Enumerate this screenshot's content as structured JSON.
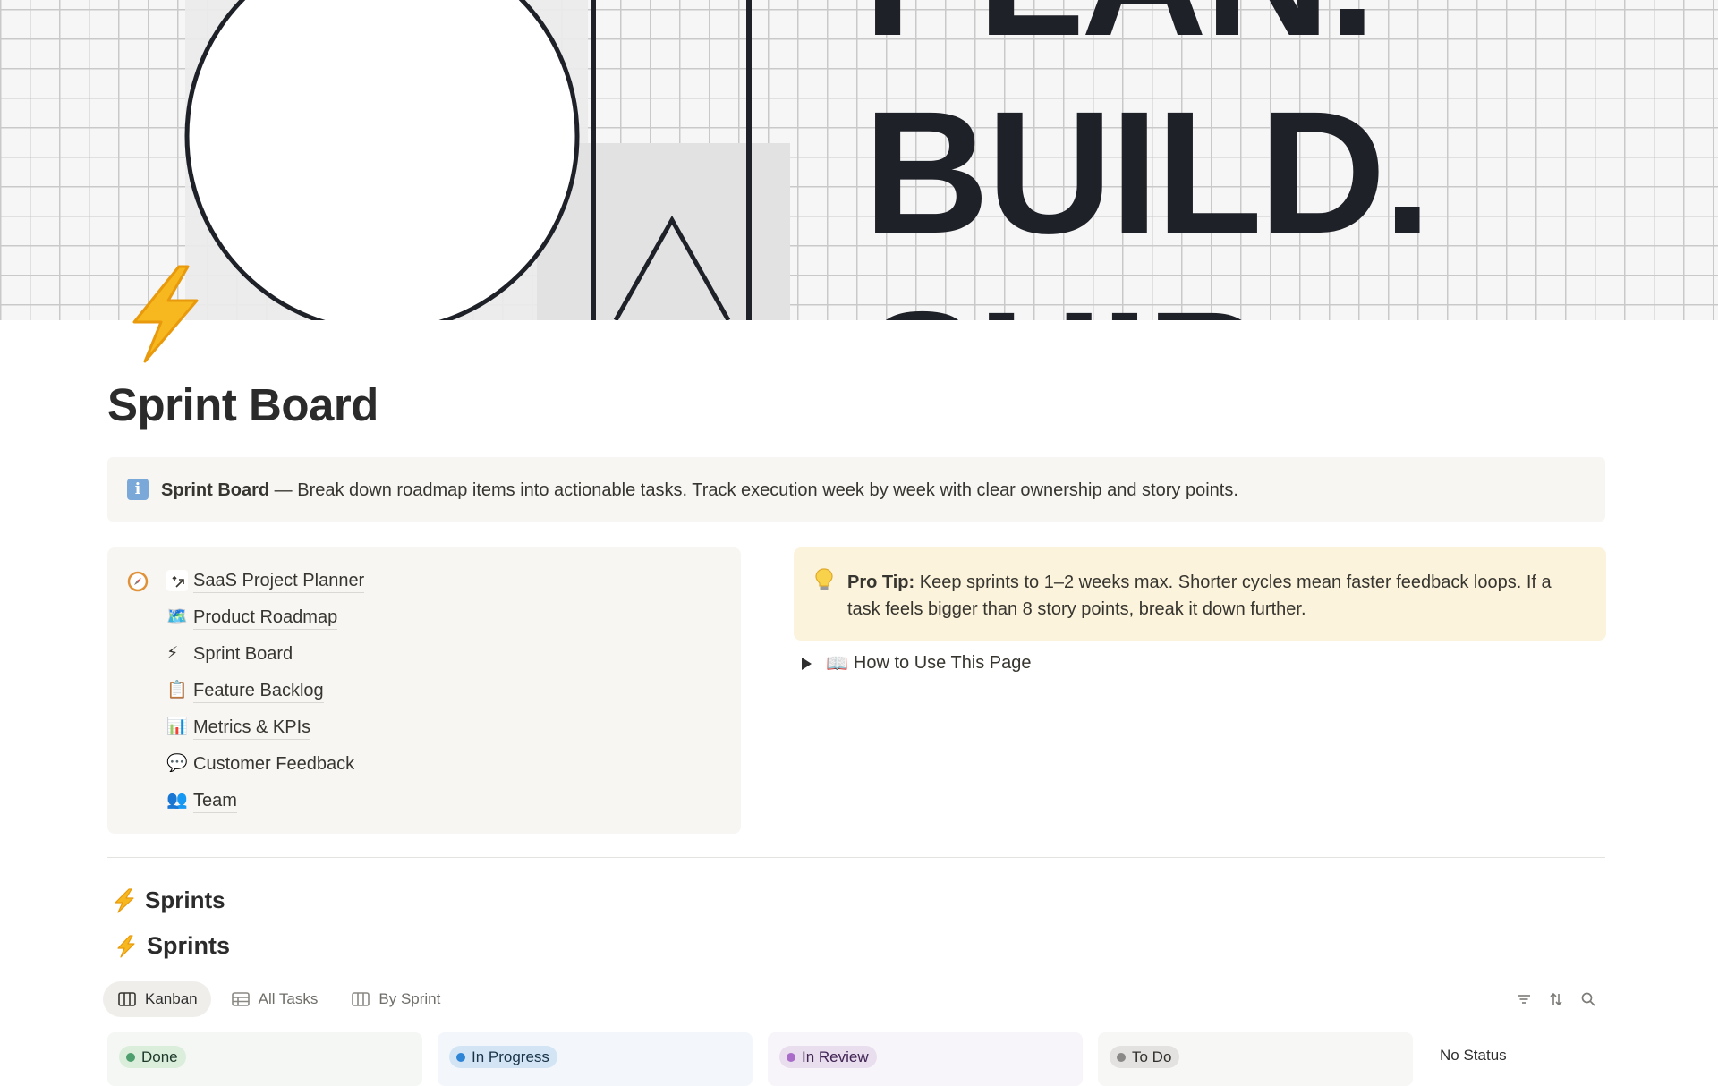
{
  "cover": {
    "line1": "PLAN.",
    "line2": "BUILD.",
    "line3": "SHIP."
  },
  "page": {
    "title": "Sprint Board"
  },
  "callout": {
    "title": "Sprint Board",
    "text": " — Break down roadmap items into actionable tasks. Track execution week by week with clear ownership and story points."
  },
  "nav": {
    "items": [
      {
        "icon": "↗",
        "label": "SaaS Project Planner"
      },
      {
        "icon": "🗺️",
        "label": "Product Roadmap"
      },
      {
        "icon": "⚡",
        "label": "Sprint Board"
      },
      {
        "icon": "📋",
        "label": "Feature Backlog"
      },
      {
        "icon": "📊",
        "label": "Metrics & KPIs"
      },
      {
        "icon": "💬",
        "label": "Customer Feedback"
      },
      {
        "icon": "👥",
        "label": "Team"
      }
    ]
  },
  "tip": {
    "lead": "Pro Tip:",
    "text": " Keep sprints to 1–2 weeks max. Shorter cycles mean faster feedback loops. If a task feels bigger than 8 story points, break it down further."
  },
  "toggle": {
    "icon": "📖",
    "label": "How to Use This Page"
  },
  "sections": {
    "heading1": "Sprints",
    "heading2": "Sprints"
  },
  "views": [
    {
      "label": "Kanban",
      "icon": "board-icon",
      "active": true
    },
    {
      "label": "All Tasks",
      "icon": "table-icon",
      "active": false
    },
    {
      "label": "By Sprint",
      "icon": "board-icon",
      "active": false
    }
  ],
  "board": {
    "columns": [
      {
        "label": "Done",
        "dot": "#4d9f6e",
        "pill_bg": "#dbeddb",
        "text": "#1c3829",
        "col_bg": "#f4f7f4"
      },
      {
        "label": "In Progress",
        "dot": "#2e85d6",
        "pill_bg": "#d3e5f5",
        "text": "#183347",
        "col_bg": "#f3f7fb"
      },
      {
        "label": "In Review",
        "dot": "#a96cc9",
        "pill_bg": "#e8deee",
        "text": "#412454",
        "col_bg": "#f8f5fa"
      },
      {
        "label": "To Do",
        "dot": "#8a8987",
        "pill_bg": "#e3e2e0",
        "text": "#32302c",
        "col_bg": "#f7f7f6"
      }
    ],
    "no_status": "No Status"
  }
}
